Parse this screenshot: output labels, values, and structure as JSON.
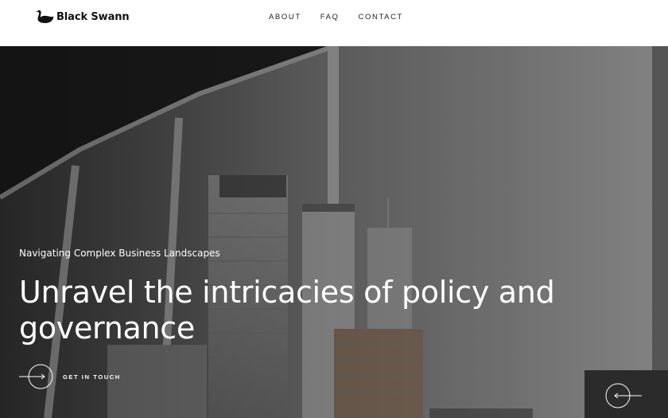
{
  "brand": {
    "name": "Black Swann",
    "logo_icon": "swan-icon"
  },
  "nav": {
    "items": [
      {
        "label": "ABOUT"
      },
      {
        "label": "FAQ"
      },
      {
        "label": "CONTACT"
      }
    ]
  },
  "hero": {
    "kicker": "Navigating Complex Business Landscapes",
    "headline": "Unravel the intricacies of policy and governance",
    "cta_label": "GET IN TOUCH",
    "cta_icon": "circle-arrow-right-icon",
    "slider_icon": "circle-arrow-left-icon"
  },
  "colors": {
    "header_bg": "#ffffff",
    "hero_overlay": "#4a4a4a",
    "slider_box": "#2b2b2b",
    "text_light": "#ffffff"
  }
}
